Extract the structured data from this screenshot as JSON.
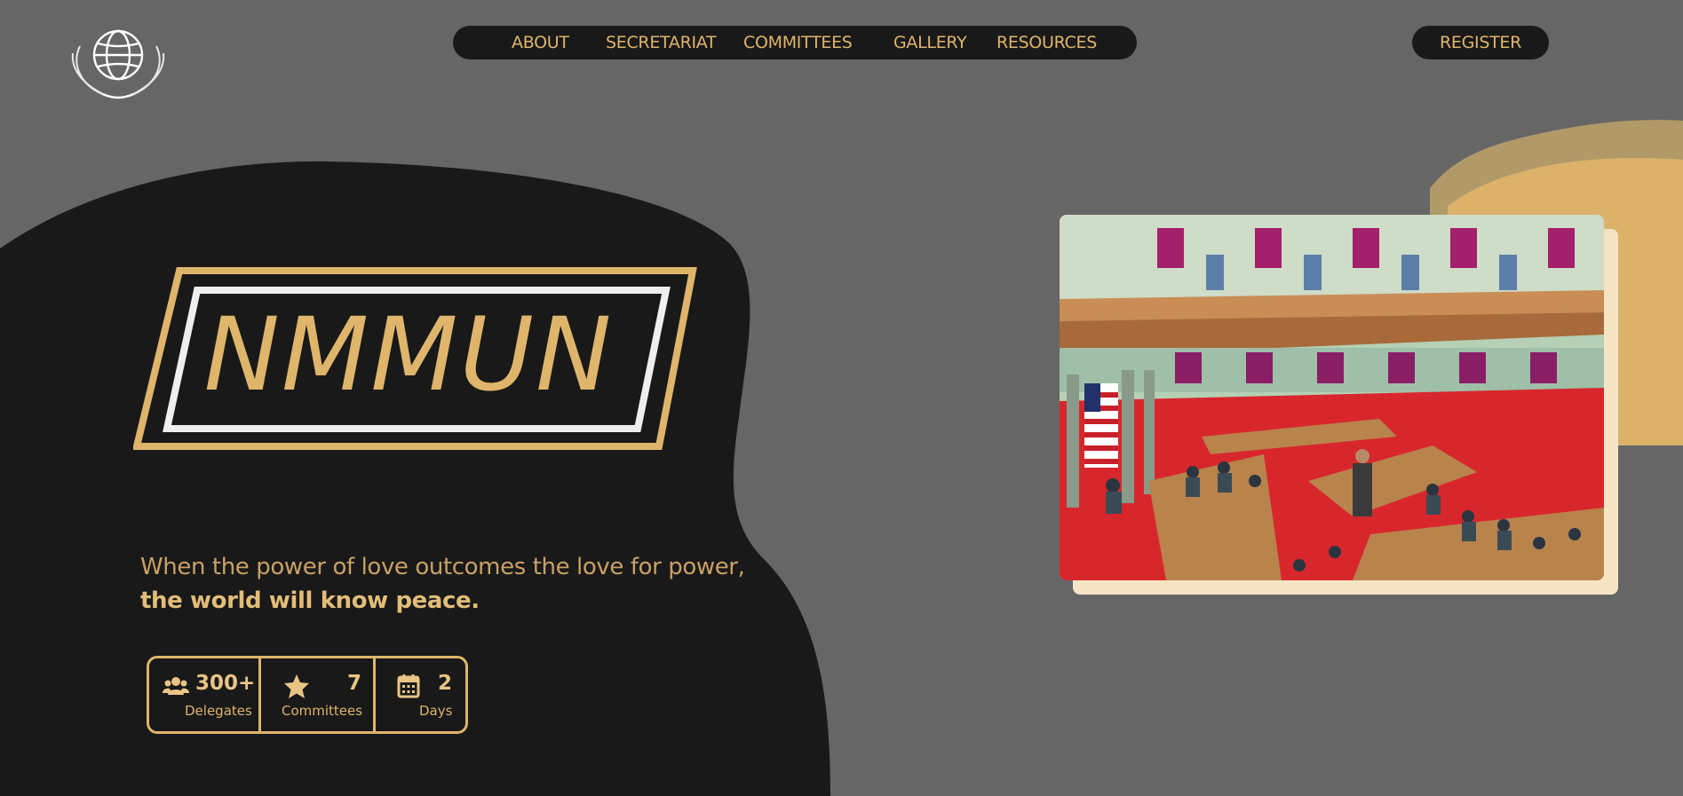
{
  "nav": {
    "items": [
      {
        "label": "ABOUT"
      },
      {
        "label": "SECRETARIAT"
      },
      {
        "label": "COMMITTEES"
      },
      {
        "label": "GALLERY"
      },
      {
        "label": "RESOURCES"
      }
    ],
    "register_label": "REGISTER"
  },
  "hero": {
    "title": "NMMUN",
    "quote_line1": "When the power of love outcomes the love for power,",
    "quote_line2": "the world will know peace."
  },
  "stats": [
    {
      "icon": "users-icon",
      "value": "300+",
      "label": "Delegates"
    },
    {
      "icon": "star-icon",
      "value": "7",
      "label": "Committees"
    },
    {
      "icon": "calendar-icon",
      "value": "2",
      "label": "Days"
    }
  ],
  "colors": {
    "background": "#666666",
    "dark_blob": "#191919",
    "gold": "#dfb56b",
    "gold_blob": "#dcb26b",
    "white_frame": "#eeeeee"
  },
  "image": {
    "subject": "assembly-hall-illustration"
  }
}
